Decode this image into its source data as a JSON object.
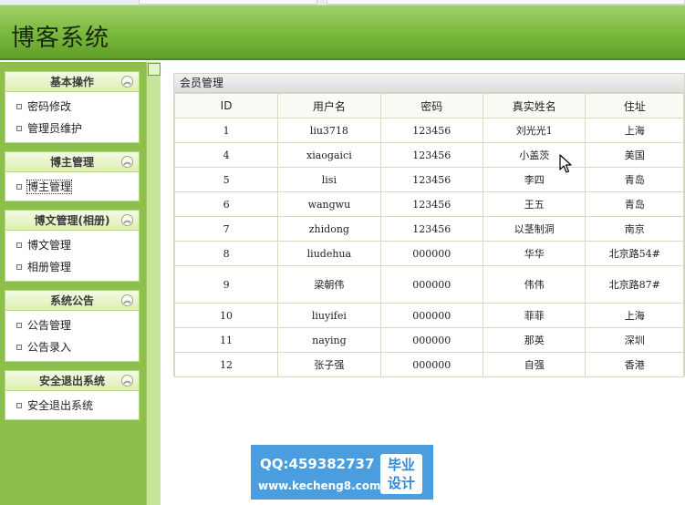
{
  "app": {
    "title": "博客系统"
  },
  "sidebar": {
    "groups": [
      {
        "title": "基本操作",
        "items": [
          "密码修改",
          "管理员维护"
        ]
      },
      {
        "title": "博主管理",
        "items": [
          "博主管理"
        ]
      },
      {
        "title": "博文管理(相册)",
        "items": [
          "博文管理",
          "相册管理"
        ]
      },
      {
        "title": "系统公告",
        "items": [
          "公告管理",
          "公告录入"
        ]
      },
      {
        "title": "安全退出系统",
        "items": [
          "安全退出系统"
        ]
      }
    ],
    "collapse_glyph": "︽"
  },
  "panel": {
    "title": "会员管理",
    "columns": [
      "ID",
      "用户名",
      "密码",
      "真实姓名",
      "住址"
    ],
    "rows": [
      [
        "1",
        "liu3718",
        "123456",
        "刘光光1",
        "上海"
      ],
      [
        "4",
        "xiaogaici",
        "123456",
        "小盖茨",
        "美国"
      ],
      [
        "5",
        "lisi",
        "123456",
        "李四",
        "青岛"
      ],
      [
        "6",
        "wangwu",
        "123456",
        "王五",
        "青岛"
      ],
      [
        "7",
        "zhidong",
        "123456",
        "以茎制洞",
        "南京"
      ],
      [
        "8",
        "liudehua",
        "000000",
        "华华",
        "北京路54#"
      ],
      [
        "9",
        "梁朝伟",
        "000000",
        "伟伟",
        "北京路87#"
      ],
      [
        "10",
        "liuyifei",
        "000000",
        "菲菲",
        "上海"
      ],
      [
        "11",
        "naying",
        "000000",
        "那英",
        "深圳"
      ],
      [
        "12",
        "张子强",
        "000000",
        "自强",
        "香港"
      ]
    ]
  },
  "watermark": {
    "qq": "QQ:459382737",
    "site": "www.kecheng8.com",
    "badge_line1": "毕业",
    "badge_line2": "设计"
  },
  "colors": {
    "header": "#79b83c",
    "sidebar": "#8cc04a",
    "watermark": "#4a9ee0"
  }
}
